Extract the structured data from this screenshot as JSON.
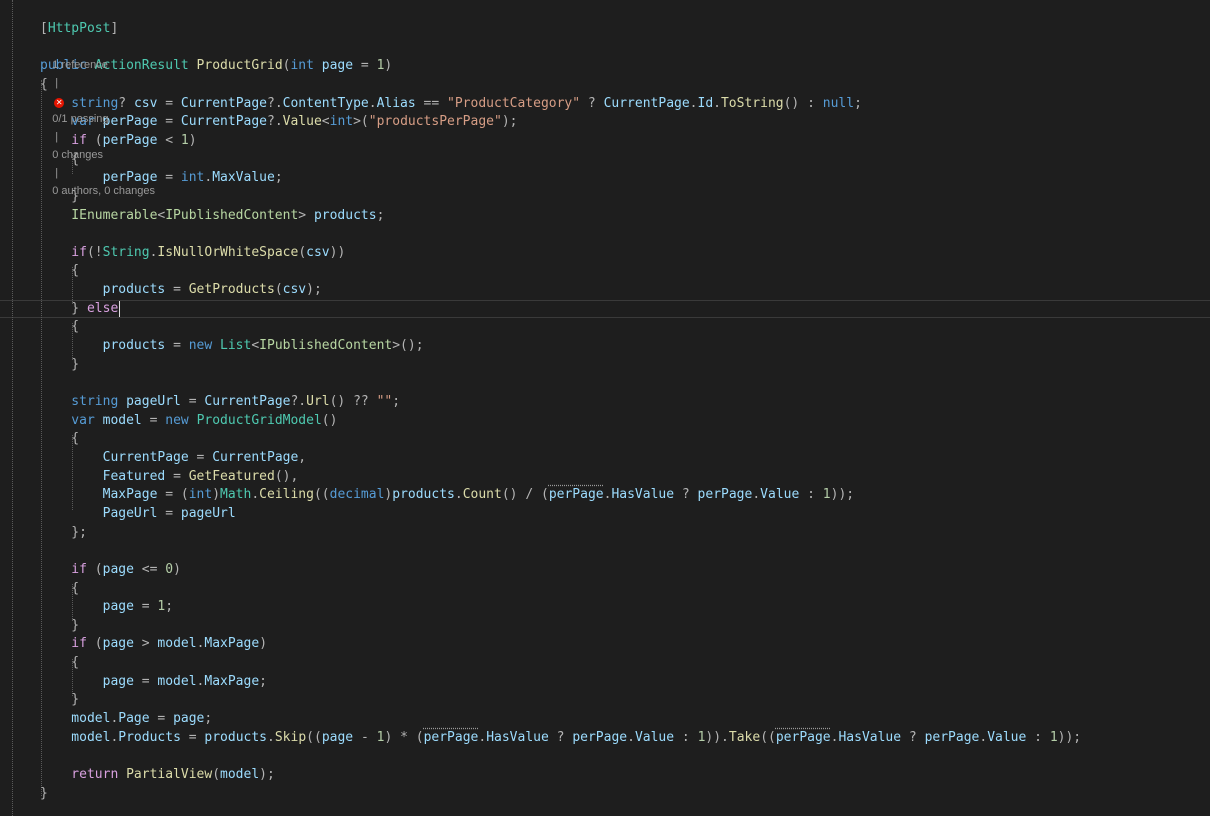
{
  "editor": {
    "language": "C#",
    "theme": "dark",
    "caret_line": 15,
    "codelens": {
      "references": "1 reference",
      "sep1": " | ",
      "tests_icon": "test-failed-icon",
      "tests": "0/1 passing",
      "sep2": " | ",
      "changes": "0 changes",
      "sep3": " | ",
      "authors": "0 authors, 0 changes"
    },
    "code_lines": [
      [
        [
          "o",
          "["
        ],
        [
          "a",
          "HttpPost"
        ],
        [
          "o",
          "]"
        ]
      ],
      null,
      [
        [
          "k",
          "public "
        ],
        [
          "t",
          "ActionResult "
        ],
        [
          "m",
          "ProductGrid"
        ],
        [
          "o",
          "("
        ],
        [
          "k",
          "int "
        ],
        [
          "p",
          "page "
        ],
        [
          "o",
          "= "
        ],
        [
          "n",
          "1"
        ],
        [
          "o",
          ")"
        ]
      ],
      [
        [
          "o",
          "{"
        ]
      ],
      [
        [
          "k",
          "    string"
        ],
        [
          "o",
          "? "
        ],
        [
          "p",
          "csv "
        ],
        [
          "o",
          "= "
        ],
        [
          "p",
          "CurrentPage"
        ],
        [
          "o",
          "?."
        ],
        [
          "p",
          "ContentType"
        ],
        [
          "o",
          "."
        ],
        [
          "p",
          "Alias "
        ],
        [
          "o",
          "== "
        ],
        [
          "s",
          "\"ProductCategory\" "
        ],
        [
          "o",
          "? "
        ],
        [
          "p",
          "CurrentPage"
        ],
        [
          "o",
          "."
        ],
        [
          "p",
          "Id"
        ],
        [
          "o",
          "."
        ],
        [
          "m",
          "ToString"
        ],
        [
          "o",
          "() : "
        ],
        [
          "k",
          "null"
        ],
        [
          "o",
          ";"
        ]
      ],
      [
        [
          "k",
          "    var "
        ],
        [
          "p",
          "perPage "
        ],
        [
          "o",
          "= "
        ],
        [
          "p",
          "CurrentPage"
        ],
        [
          "o",
          "?."
        ],
        [
          "m",
          "Value"
        ],
        [
          "o",
          "<"
        ],
        [
          "k",
          "int"
        ],
        [
          "o",
          ">("
        ],
        [
          "s",
          "\"productsPerPage\""
        ],
        [
          "o",
          ");"
        ]
      ],
      [
        [
          "c",
          "    if "
        ],
        [
          "o",
          "("
        ],
        [
          "p",
          "perPage "
        ],
        [
          "o",
          "< "
        ],
        [
          "n",
          "1"
        ],
        [
          "o",
          ")"
        ]
      ],
      [
        [
          "o",
          "    {"
        ]
      ],
      [
        [
          "p",
          "        perPage "
        ],
        [
          "o",
          "= "
        ],
        [
          "k",
          "int"
        ],
        [
          "o",
          "."
        ],
        [
          "p",
          "MaxValue"
        ],
        [
          "o",
          ";"
        ]
      ],
      [
        [
          "o",
          "    }"
        ]
      ],
      [
        [
          "i",
          "    IEnumerable"
        ],
        [
          "o",
          "<"
        ],
        [
          "i",
          "IPublishedContent"
        ],
        [
          "o",
          "> "
        ],
        [
          "p",
          "products"
        ],
        [
          "o",
          ";"
        ]
      ],
      [],
      [
        [
          "c",
          "    if"
        ],
        [
          "o",
          "(!"
        ],
        [
          "t",
          "String"
        ],
        [
          "o",
          "."
        ],
        [
          "m",
          "IsNullOrWhiteSpace"
        ],
        [
          "o",
          "("
        ],
        [
          "p",
          "csv"
        ],
        [
          "o",
          "))"
        ]
      ],
      [
        [
          "o",
          "    {"
        ]
      ],
      [
        [
          "p",
          "        products "
        ],
        [
          "o",
          "= "
        ],
        [
          "m",
          "GetProducts"
        ],
        [
          "o",
          "("
        ],
        [
          "p",
          "csv"
        ],
        [
          "o",
          ");"
        ]
      ],
      [
        [
          "o",
          "    } "
        ],
        [
          "c",
          "else"
        ]
      ],
      [
        [
          "o",
          "    {"
        ]
      ],
      [
        [
          "p",
          "        products "
        ],
        [
          "o",
          "= "
        ],
        [
          "k",
          "new "
        ],
        [
          "t",
          "List"
        ],
        [
          "o",
          "<"
        ],
        [
          "i",
          "IPublishedContent"
        ],
        [
          "o",
          ">();"
        ]
      ],
      [
        [
          "o",
          "    }"
        ]
      ],
      [],
      [
        [
          "k",
          "    string "
        ],
        [
          "p",
          "pageUrl "
        ],
        [
          "o",
          "= "
        ],
        [
          "p",
          "CurrentPage"
        ],
        [
          "o",
          "?."
        ],
        [
          "m",
          "Url"
        ],
        [
          "o",
          "() ?? "
        ],
        [
          "s",
          "\"\""
        ],
        [
          "o",
          ";"
        ]
      ],
      [
        [
          "k",
          "    var "
        ],
        [
          "p",
          "model "
        ],
        [
          "o",
          "= "
        ],
        [
          "k",
          "new "
        ],
        [
          "t",
          "ProductGridModel"
        ],
        [
          "o",
          "()"
        ]
      ],
      [
        [
          "o",
          "    {"
        ]
      ],
      [
        [
          "p",
          "        CurrentPage "
        ],
        [
          "o",
          "= "
        ],
        [
          "p",
          "CurrentPage"
        ],
        [
          "o",
          ","
        ]
      ],
      [
        [
          "p",
          "        Featured "
        ],
        [
          "o",
          "= "
        ],
        [
          "m",
          "GetFeatured"
        ],
        [
          "o",
          "(),"
        ]
      ],
      [
        [
          "p",
          "        MaxPage "
        ],
        [
          "o",
          "= ("
        ],
        [
          "k",
          "int"
        ],
        [
          "o",
          ")"
        ],
        [
          "t",
          "Math"
        ],
        [
          "o",
          "."
        ],
        [
          "m",
          "Ceiling"
        ],
        [
          "o",
          "(("
        ],
        [
          "k",
          "decimal"
        ],
        [
          "o",
          ")"
        ],
        [
          "p",
          "products"
        ],
        [
          "o",
          "."
        ],
        [
          "m",
          "Count"
        ],
        [
          "o",
          "() / ("
        ],
        [
          "pd",
          "perPage"
        ],
        [
          "o",
          "."
        ],
        [
          "p",
          "HasValue "
        ],
        [
          "o",
          "? "
        ],
        [
          "p",
          "perPage"
        ],
        [
          "o",
          "."
        ],
        [
          "p",
          "Value "
        ],
        [
          "o",
          ": "
        ],
        [
          "n",
          "1"
        ],
        [
          "o",
          "));"
        ]
      ],
      [
        [
          "p",
          "        PageUrl "
        ],
        [
          "o",
          "= "
        ],
        [
          "p",
          "pageUrl"
        ]
      ],
      [
        [
          "o",
          "    };"
        ]
      ],
      [],
      [
        [
          "c",
          "    if "
        ],
        [
          "o",
          "("
        ],
        [
          "p",
          "page "
        ],
        [
          "o",
          "<= "
        ],
        [
          "n",
          "0"
        ],
        [
          "o",
          ")"
        ]
      ],
      [
        [
          "o",
          "    {"
        ]
      ],
      [
        [
          "p",
          "        page "
        ],
        [
          "o",
          "= "
        ],
        [
          "n",
          "1"
        ],
        [
          "o",
          ";"
        ]
      ],
      [
        [
          "o",
          "    }"
        ]
      ],
      [
        [
          "c",
          "    if "
        ],
        [
          "o",
          "("
        ],
        [
          "p",
          "page "
        ],
        [
          "o",
          "> "
        ],
        [
          "p",
          "model"
        ],
        [
          "o",
          "."
        ],
        [
          "p",
          "MaxPage"
        ],
        [
          "o",
          ")"
        ]
      ],
      [
        [
          "o",
          "    {"
        ]
      ],
      [
        [
          "p",
          "        page "
        ],
        [
          "o",
          "= "
        ],
        [
          "p",
          "model"
        ],
        [
          "o",
          "."
        ],
        [
          "p",
          "MaxPage"
        ],
        [
          "o",
          ";"
        ]
      ],
      [
        [
          "o",
          "    }"
        ]
      ],
      [
        [
          "p",
          "    model"
        ],
        [
          "o",
          "."
        ],
        [
          "p",
          "Page "
        ],
        [
          "o",
          "= "
        ],
        [
          "p",
          "page"
        ],
        [
          "o",
          ";"
        ]
      ],
      [
        [
          "p",
          "    model"
        ],
        [
          "o",
          "."
        ],
        [
          "p",
          "Products "
        ],
        [
          "o",
          "= "
        ],
        [
          "p",
          "products"
        ],
        [
          "o",
          "."
        ],
        [
          "m",
          "Skip"
        ],
        [
          "o",
          "(("
        ],
        [
          "p",
          "page "
        ],
        [
          "o",
          "- "
        ],
        [
          "n",
          "1"
        ],
        [
          "o",
          ") * ("
        ],
        [
          "pd",
          "perPage"
        ],
        [
          "o",
          "."
        ],
        [
          "p",
          "HasValue "
        ],
        [
          "o",
          "? "
        ],
        [
          "p",
          "perPage"
        ],
        [
          "o",
          "."
        ],
        [
          "p",
          "Value "
        ],
        [
          "o",
          ": "
        ],
        [
          "n",
          "1"
        ],
        [
          "o",
          "))."
        ],
        [
          "m",
          "Take"
        ],
        [
          "o",
          "(("
        ],
        [
          "pd",
          "perPage"
        ],
        [
          "o",
          "."
        ],
        [
          "p",
          "HasValue "
        ],
        [
          "o",
          "? "
        ],
        [
          "p",
          "perPage"
        ],
        [
          "o",
          "."
        ],
        [
          "p",
          "Value "
        ],
        [
          "o",
          ": "
        ],
        [
          "n",
          "1"
        ],
        [
          "o",
          "));"
        ]
      ],
      [],
      [
        [
          "c",
          "    return "
        ],
        [
          "m",
          "PartialView"
        ],
        [
          "o",
          "("
        ],
        [
          "p",
          "model"
        ],
        [
          "o",
          ");"
        ]
      ],
      [
        [
          "o",
          "}"
        ]
      ]
    ]
  }
}
